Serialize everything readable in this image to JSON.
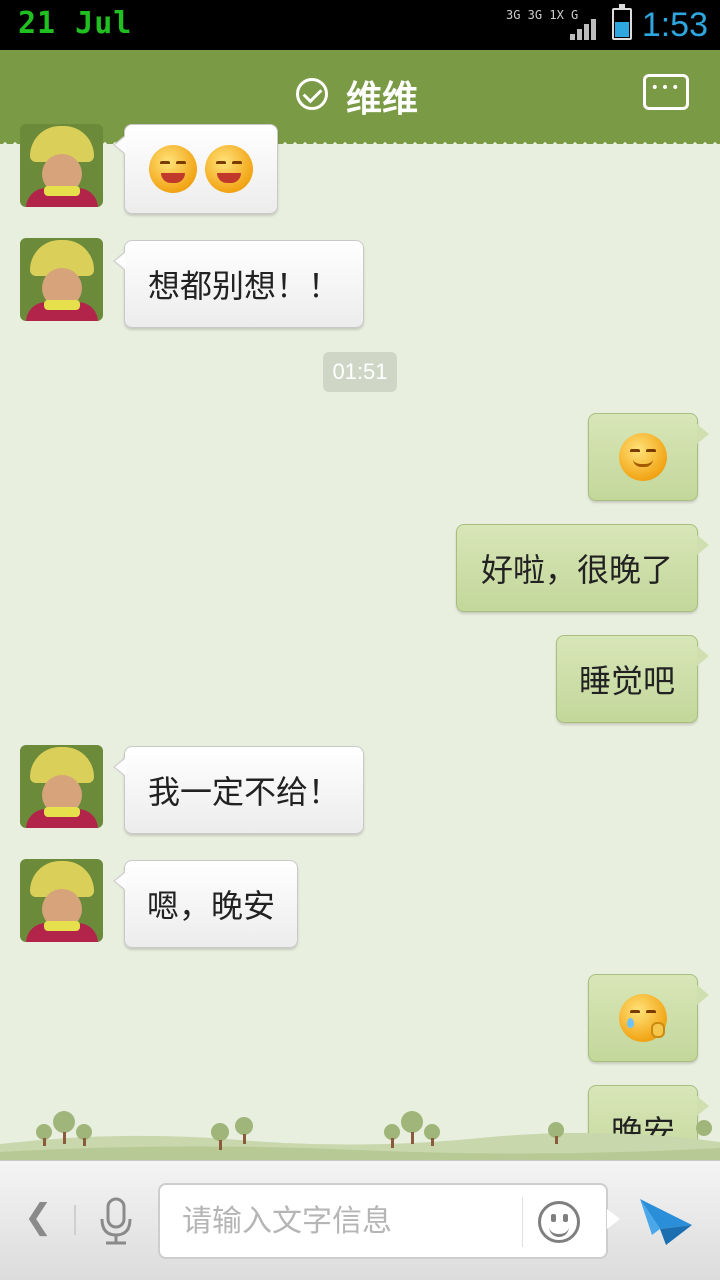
{
  "status_bar": {
    "date": "21 Jul",
    "network_label": "3G 3G 1X G",
    "time": "1:53",
    "battery_level": 0.55,
    "colors": {
      "date": "#20c020",
      "time": "#2ea6df"
    }
  },
  "header": {
    "title": "维维",
    "verified_icon": "check-circle-icon",
    "more_icon": "chat-more-icon",
    "background": "#7a9a45"
  },
  "messages": [
    {
      "from": "contact",
      "type": "emoji",
      "emoji": [
        "grin-squint-icon",
        "grin-squint-icon"
      ]
    },
    {
      "from": "contact",
      "type": "text",
      "text": "想都别想！！"
    },
    {
      "type": "timestamp",
      "text": "01:51"
    },
    {
      "from": "me",
      "type": "emoji",
      "emoji": [
        "content-smile-icon"
      ]
    },
    {
      "from": "me",
      "type": "text",
      "text": "好啦，很晚了"
    },
    {
      "from": "me",
      "type": "text",
      "text": "睡觉吧"
    },
    {
      "from": "contact",
      "type": "text",
      "text": "我一定不给！"
    },
    {
      "from": "contact",
      "type": "text",
      "text": "嗯，晚安"
    },
    {
      "from": "me",
      "type": "emoji",
      "emoji": [
        "wipe-tear-icon"
      ]
    },
    {
      "from": "me",
      "type": "text",
      "text": "晚安"
    }
  ],
  "input_bar": {
    "placeholder": "请输入文字信息",
    "value": "",
    "back_icon": "chevron-left-icon",
    "mic_icon": "microphone-icon",
    "emoji_icon": "smiley-icon",
    "send_icon": "send-plane-icon",
    "send_color": "#2a8fd8"
  },
  "colors": {
    "chat_background": "#e9efdf",
    "incoming_bubble": "#ffffff",
    "outgoing_bubble": "#c8dba2"
  }
}
